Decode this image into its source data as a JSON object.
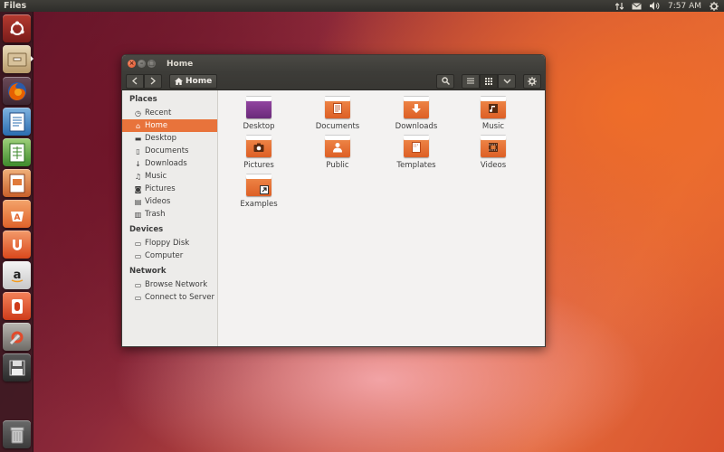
{
  "top_panel": {
    "app_title": "Files",
    "time": "7:57 AM"
  },
  "launcher": {
    "items": [
      {
        "name": "dash",
        "icon": "ubuntu-logo-icon"
      },
      {
        "name": "files",
        "icon": "file-manager-icon"
      },
      {
        "name": "firefox",
        "icon": "firefox-icon"
      },
      {
        "name": "writer",
        "icon": "libreoffice-writer-icon"
      },
      {
        "name": "calc",
        "icon": "libreoffice-calc-icon"
      },
      {
        "name": "impress",
        "icon": "libreoffice-impress-icon"
      },
      {
        "name": "software-center",
        "icon": "software-center-icon"
      },
      {
        "name": "ubuntu-one",
        "icon": "ubuntu-one-icon"
      },
      {
        "name": "amazon",
        "icon": "amazon-icon"
      },
      {
        "name": "ubuntu-one-music",
        "icon": "ubuntu-one-music-icon"
      },
      {
        "name": "system-settings",
        "icon": "system-settings-icon"
      },
      {
        "name": "floppy",
        "icon": "floppy-disk-icon"
      },
      {
        "name": "trash",
        "icon": "trash-icon"
      }
    ]
  },
  "window": {
    "title": "Home",
    "breadcrumb": "Home"
  },
  "sidebar": {
    "places_header": "Places",
    "places": [
      {
        "label": "Recent",
        "icon": "clock-icon"
      },
      {
        "label": "Home",
        "icon": "home-icon",
        "active": true
      },
      {
        "label": "Desktop",
        "icon": "folder-icon"
      },
      {
        "label": "Documents",
        "icon": "document-icon"
      },
      {
        "label": "Downloads",
        "icon": "download-icon"
      },
      {
        "label": "Music",
        "icon": "music-note-icon"
      },
      {
        "label": "Pictures",
        "icon": "camera-icon"
      },
      {
        "label": "Videos",
        "icon": "film-icon"
      },
      {
        "label": "Trash",
        "icon": "trash-icon"
      }
    ],
    "devices_header": "Devices",
    "devices": [
      {
        "label": "Floppy Disk",
        "icon": "floppy-icon"
      },
      {
        "label": "Computer",
        "icon": "computer-icon"
      }
    ],
    "network_header": "Network",
    "network": [
      {
        "label": "Browse Network",
        "icon": "network-icon"
      },
      {
        "label": "Connect to Server",
        "icon": "server-icon"
      }
    ]
  },
  "files": [
    {
      "label": "Desktop",
      "icon": "desktop-folder-icon"
    },
    {
      "label": "Documents",
      "icon": "documents-folder-icon"
    },
    {
      "label": "Downloads",
      "icon": "downloads-folder-icon"
    },
    {
      "label": "Music",
      "icon": "music-folder-icon"
    },
    {
      "label": "Pictures",
      "icon": "pictures-folder-icon"
    },
    {
      "label": "Public",
      "icon": "public-folder-icon"
    },
    {
      "label": "Templates",
      "icon": "templates-folder-icon"
    },
    {
      "label": "Videos",
      "icon": "videos-folder-icon"
    },
    {
      "label": "Examples",
      "icon": "examples-folder-icon"
    }
  ],
  "colors": {
    "accent": "#e8733b",
    "panel": "#3c3b37"
  }
}
